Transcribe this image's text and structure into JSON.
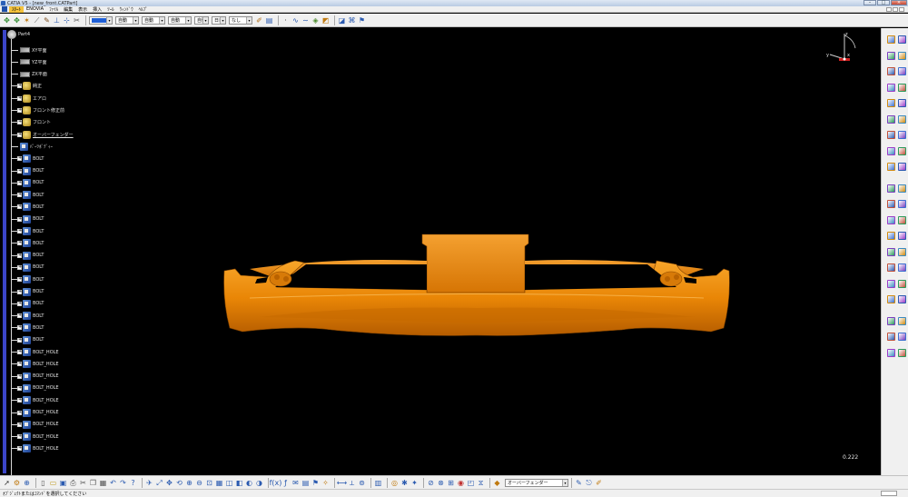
{
  "window": {
    "title": "CATIA V5 - [new_front.CATPart]",
    "buttons": [
      "–",
      "□",
      "×"
    ]
  },
  "menu": {
    "items": [
      "ｽﾀｰﾄ",
      "ENOVIA",
      "ﾌｧｲﾙ",
      "編集",
      "表示",
      "挿入",
      "ﾂｰﾙ",
      "ｳｨﾝﾄﾞｳ",
      "ﾍﾙﾌﾟ"
    ],
    "active_index": 0
  },
  "toolbar": {
    "combos": [
      {
        "value": "",
        "type": "color",
        "color": "#1f5fd6"
      },
      {
        "value": "自動"
      },
      {
        "value": "自動"
      },
      {
        "value": "自動"
      },
      {
        "value": "自動"
      },
      {
        "value": "日目"
      },
      {
        "value": "なし"
      }
    ]
  },
  "tree": {
    "root": "Part4",
    "items": [
      {
        "label": "XY平面",
        "icon": "plane-icon",
        "expandable": false
      },
      {
        "label": "YZ平面",
        "icon": "plane-icon",
        "expandable": false
      },
      {
        "label": "ZX平面",
        "icon": "plane-icon",
        "expandable": false
      },
      {
        "label": "純正",
        "icon": "body-icon",
        "expandable": true
      },
      {
        "label": "エアロ",
        "icon": "body-icon",
        "expandable": true
      },
      {
        "label": "フロント修正前",
        "icon": "body-icon",
        "expandable": true
      },
      {
        "label": "フロント",
        "icon": "body-icon",
        "expandable": true
      },
      {
        "label": "オーバーフェンダー",
        "icon": "body-icon",
        "expandable": true,
        "selected": true
      },
      {
        "label": "ﾊﾟｰﾂﾎﾞﾃﾞｨｰ",
        "icon": "part-body-icon",
        "expandable": false
      },
      {
        "label": "BOLT",
        "icon": "part-body-icon",
        "expandable": true
      },
      {
        "label": "BOLT",
        "icon": "part-body-icon",
        "expandable": true
      },
      {
        "label": "BOLT",
        "icon": "part-body-icon",
        "expandable": true
      },
      {
        "label": "BOLT",
        "icon": "part-body-icon",
        "expandable": true
      },
      {
        "label": "BOLT",
        "icon": "part-body-icon",
        "expandable": true
      },
      {
        "label": "BOLT",
        "icon": "part-body-icon",
        "expandable": true
      },
      {
        "label": "BOLT",
        "icon": "part-body-icon",
        "expandable": true
      },
      {
        "label": "BOLT",
        "icon": "part-body-icon",
        "expandable": true
      },
      {
        "label": "BOLT",
        "icon": "part-body-icon",
        "expandable": true
      },
      {
        "label": "BOLT",
        "icon": "part-body-icon",
        "expandable": true
      },
      {
        "label": "BOLT",
        "icon": "part-body-icon",
        "expandable": true
      },
      {
        "label": "BOLT",
        "icon": "part-body-icon",
        "expandable": true
      },
      {
        "label": "BOLT",
        "icon": "part-body-icon",
        "expandable": true
      },
      {
        "label": "BOLT",
        "icon": "part-body-icon",
        "expandable": true
      },
      {
        "label": "BOLT",
        "icon": "part-body-icon",
        "expandable": true
      },
      {
        "label": "BOLT",
        "icon": "part-body-icon",
        "expandable": true
      },
      {
        "label": "BOLT_HOLE",
        "icon": "part-body-icon",
        "expandable": true
      },
      {
        "label": "BOLT_HOLE",
        "icon": "part-body-icon",
        "expandable": true
      },
      {
        "label": "BOLT_HOLE",
        "icon": "part-body-icon",
        "expandable": true
      },
      {
        "label": "BOLT_HOLE",
        "icon": "part-body-icon",
        "expandable": true
      },
      {
        "label": "BOLT_HOLE",
        "icon": "part-body-icon",
        "expandable": true
      },
      {
        "label": "BOLT_HOLE",
        "icon": "part-body-icon",
        "expandable": true
      },
      {
        "label": "BOLT_HOLE",
        "icon": "part-body-icon",
        "expandable": true
      },
      {
        "label": "BOLT_HOLE",
        "icon": "part-body-icon",
        "expandable": true
      },
      {
        "label": "BOLT_HOLE",
        "icon": "part-body-icon",
        "expandable": true
      }
    ]
  },
  "viewport": {
    "scale_text": "0.222",
    "part_color": "#f08a10",
    "background": "#000000"
  },
  "compass": {
    "x_label": "x",
    "y_label": "y",
    "z_label": "z"
  },
  "bottom": {
    "current_body": "オーバーフェンダー"
  },
  "status": {
    "text": "ｵﾌﾞｼﾞｪｸﾄまたはｺﾏﾝﾄﾞを選択してください"
  }
}
